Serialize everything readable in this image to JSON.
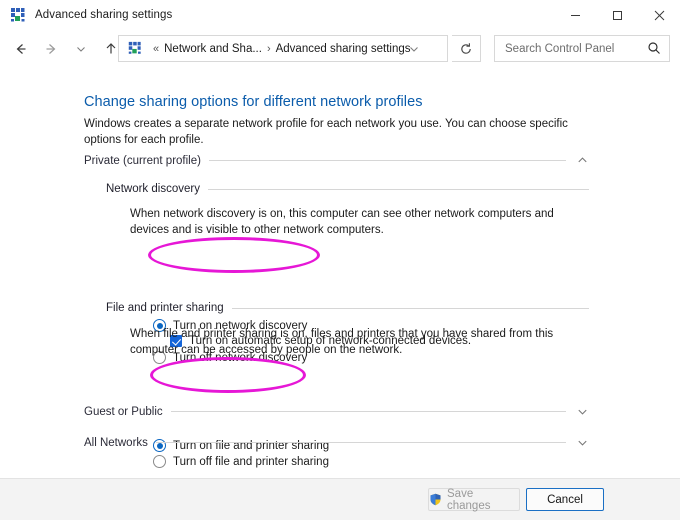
{
  "window": {
    "title": "Advanced sharing settings",
    "icon": "network-sharing-icon",
    "minimize_label": "Minimize",
    "maximize_label": "Maximize",
    "close_label": "Close"
  },
  "nav": {
    "back_label": "Back",
    "forward_label": "Forward",
    "recent_label": "Recent locations",
    "up_label": "Up",
    "refresh_label": "Refresh",
    "breadcrumb": {
      "overflow": "«",
      "parent": "Network and Sha...",
      "separator": "›",
      "current": "Advanced sharing settings"
    }
  },
  "search": {
    "placeholder": "Search Control Panel",
    "value": ""
  },
  "page": {
    "title": "Change sharing options for different network profiles",
    "description": "Windows creates a separate network profile for each network you use. You can choose specific options for each profile."
  },
  "sections": [
    {
      "id": "private",
      "label": "Private (current profile)",
      "expanded": true,
      "chevron": "chevron-up-icon"
    },
    {
      "id": "guest-or-public",
      "label": "Guest or Public",
      "expanded": false,
      "chevron": "chevron-down-icon"
    },
    {
      "id": "all-networks",
      "label": "All Networks",
      "expanded": false,
      "chevron": "chevron-down-icon"
    }
  ],
  "network_discovery": {
    "heading": "Network discovery",
    "description": "When network discovery is on, this computer can see other network computers and devices and is visible to other network computers.",
    "options": [
      {
        "label": "Turn on network discovery",
        "selected": true
      },
      {
        "label": "Turn off network discovery",
        "selected": false
      }
    ],
    "checkbox": {
      "label": "Turn on automatic setup of network-connected devices.",
      "checked": true
    }
  },
  "file_printer_sharing": {
    "heading": "File and printer sharing",
    "description": "When file and printer sharing is on, files and printers that you have shared from this computer can be accessed by people on the network.",
    "options": [
      {
        "label": "Turn on file and printer sharing",
        "selected": true
      },
      {
        "label": "Turn off file and printer sharing",
        "selected": false
      }
    ]
  },
  "annotations": {
    "color": "#e617d6",
    "shapes": [
      {
        "name": "highlight-network-discovery",
        "target": "Turn on network discovery"
      },
      {
        "name": "highlight-file-printer-sharing",
        "target": "Turn on file and printer sharing"
      }
    ]
  },
  "footer": {
    "save_label": "Save changes",
    "save_icon": "uac-shield-icon",
    "save_enabled": false,
    "cancel_label": "Cancel"
  }
}
